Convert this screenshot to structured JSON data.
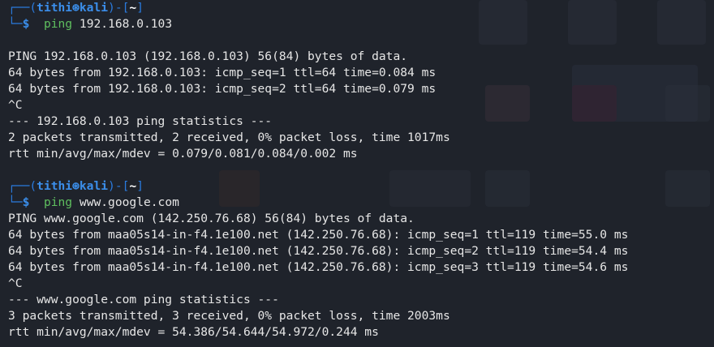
{
  "prompt": {
    "user": "tithi",
    "separator": "⊛",
    "host": "kali",
    "dir": "~",
    "symbol": "$"
  },
  "sessions": [
    {
      "command": "ping",
      "argument": "192.168.0.103",
      "blank_after_command": true,
      "output": [
        "PING 192.168.0.103 (192.168.0.103) 56(84) bytes of data.",
        "64 bytes from 192.168.0.103: icmp_seq=1 ttl=64 time=0.084 ms",
        "64 bytes from 192.168.0.103: icmp_seq=2 ttl=64 time=0.079 ms",
        "^C",
        "--- 192.168.0.103 ping statistics ---",
        "2 packets transmitted, 2 received, 0% packet loss, time 1017ms",
        "rtt min/avg/max/mdev = 0.079/0.081/0.084/0.002 ms"
      ]
    },
    {
      "command": "ping",
      "argument": "www.google.com",
      "blank_after_command": false,
      "output": [
        "PING www.google.com (142.250.76.68) 56(84) bytes of data.",
        "64 bytes from maa05s14-in-f4.1e100.net (142.250.76.68): icmp_seq=1 ttl=119 time=55.0 ms",
        "64 bytes from maa05s14-in-f4.1e100.net (142.250.76.68): icmp_seq=2 ttl=119 time=54.4 ms",
        "64 bytes from maa05s14-in-f4.1e100.net (142.250.76.68): icmp_seq=3 ttl=119 time=54.6 ms",
        "^C",
        "--- www.google.com ping statistics ---",
        "3 packets transmitted, 3 received, 0% packet loss, time 2003ms",
        "rtt min/avg/max/mdev = 54.386/54.644/54.972/0.244 ms"
      ]
    }
  ]
}
